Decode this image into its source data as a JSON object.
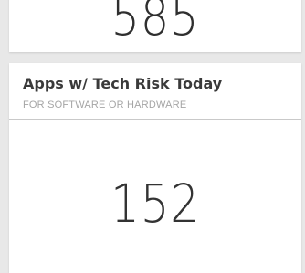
{
  "cards": [
    {
      "value": "585"
    },
    {
      "title": "Apps w/ Tech Risk Today",
      "subtitle": "FOR SOFTWARE OR HARDWARE",
      "value": "152"
    }
  ]
}
